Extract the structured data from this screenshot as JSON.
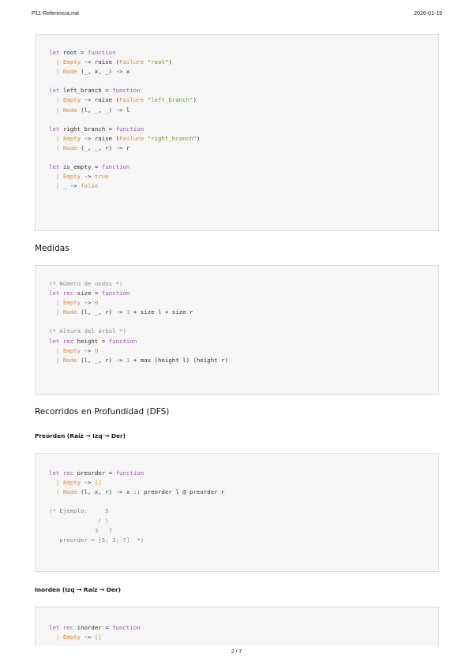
{
  "header": {
    "file_name": "P11-Referencia.md",
    "date": "2026-01-19"
  },
  "footer": {
    "page": "2 / 7"
  },
  "sections": {
    "medidas": "Medidas",
    "dfs": "Recorridos en Profundidad (DFS)",
    "preorden": "Preorden (Raíz → Izq → Der)",
    "inorden": "Inorden (Izq → Raíz → Der)"
  },
  "code_blocks": {
    "block1": [
      [
        {
          "t": "let ",
          "c": "kw"
        },
        {
          "t": "root = "
        },
        {
          "t": "function",
          "c": "kw"
        }
      ],
      [
        {
          "t": "  "
        },
        {
          "t": "|",
          "c": "bar"
        },
        {
          "t": " "
        },
        {
          "t": "Empty",
          "c": "ctor"
        },
        {
          "t": " -> raise ("
        },
        {
          "t": "Failure",
          "c": "ctor"
        },
        {
          "t": " "
        },
        {
          "t": "\"root\"",
          "c": "str"
        },
        {
          "t": ")"
        }
      ],
      [
        {
          "t": "  "
        },
        {
          "t": "|",
          "c": "bar"
        },
        {
          "t": " "
        },
        {
          "t": "Node",
          "c": "ctor"
        },
        {
          "t": " (_, x, _) -> x"
        }
      ],
      [
        {
          "t": ""
        }
      ],
      [
        {
          "t": "let ",
          "c": "kw"
        },
        {
          "t": "left_branch = "
        },
        {
          "t": "function",
          "c": "kw"
        }
      ],
      [
        {
          "t": "  "
        },
        {
          "t": "|",
          "c": "bar"
        },
        {
          "t": " "
        },
        {
          "t": "Empty",
          "c": "ctor"
        },
        {
          "t": " -> raise ("
        },
        {
          "t": "Failure",
          "c": "ctor"
        },
        {
          "t": " "
        },
        {
          "t": "\"left_branch\"",
          "c": "str"
        },
        {
          "t": ")"
        }
      ],
      [
        {
          "t": "  "
        },
        {
          "t": "|",
          "c": "bar"
        },
        {
          "t": " "
        },
        {
          "t": "Node",
          "c": "ctor"
        },
        {
          "t": " (l, _, _) -> l"
        }
      ],
      [
        {
          "t": ""
        }
      ],
      [
        {
          "t": "let ",
          "c": "kw"
        },
        {
          "t": "right_branch = "
        },
        {
          "t": "function",
          "c": "kw"
        }
      ],
      [
        {
          "t": "  "
        },
        {
          "t": "|",
          "c": "bar"
        },
        {
          "t": " "
        },
        {
          "t": "Empty",
          "c": "ctor"
        },
        {
          "t": " -> raise ("
        },
        {
          "t": "Failure",
          "c": "ctor"
        },
        {
          "t": " "
        },
        {
          "t": "\"right_branch\"",
          "c": "str"
        },
        {
          "t": ")"
        }
      ],
      [
        {
          "t": "  "
        },
        {
          "t": "|",
          "c": "bar"
        },
        {
          "t": " "
        },
        {
          "t": "Node",
          "c": "ctor"
        },
        {
          "t": " (_, _, r) -> r"
        }
      ],
      [
        {
          "t": ""
        }
      ],
      [
        {
          "t": "let ",
          "c": "kw"
        },
        {
          "t": "is_empty = "
        },
        {
          "t": "function",
          "c": "kw"
        }
      ],
      [
        {
          "t": "  "
        },
        {
          "t": "|",
          "c": "bar"
        },
        {
          "t": " "
        },
        {
          "t": "Empty",
          "c": "ctor"
        },
        {
          "t": " -> "
        },
        {
          "t": "true",
          "c": "ctor"
        }
      ],
      [
        {
          "t": "  "
        },
        {
          "t": "|",
          "c": "bar"
        },
        {
          "t": " _ -> "
        },
        {
          "t": "false",
          "c": "ctor"
        }
      ]
    ],
    "block2": [
      [
        {
          "t": "(* Número de nodos *)",
          "c": "cm"
        }
      ],
      [
        {
          "t": "let ",
          "c": "kw"
        },
        {
          "t": "rec ",
          "c": "kw"
        },
        {
          "t": "size = "
        },
        {
          "t": "function",
          "c": "kw"
        }
      ],
      [
        {
          "t": "  "
        },
        {
          "t": "|",
          "c": "bar"
        },
        {
          "t": " "
        },
        {
          "t": "Empty",
          "c": "ctor"
        },
        {
          "t": " -> "
        },
        {
          "t": "0",
          "c": "num"
        }
      ],
      [
        {
          "t": "  "
        },
        {
          "t": "|",
          "c": "bar"
        },
        {
          "t": " "
        },
        {
          "t": "Node",
          "c": "ctor"
        },
        {
          "t": " (l, _, r) -> "
        },
        {
          "t": "1",
          "c": "num"
        },
        {
          "t": " + size l + size r"
        }
      ],
      [
        {
          "t": ""
        }
      ],
      [
        {
          "t": "(* Altura del árbol *)",
          "c": "cm"
        }
      ],
      [
        {
          "t": "let ",
          "c": "kw"
        },
        {
          "t": "rec ",
          "c": "kw"
        },
        {
          "t": "height = "
        },
        {
          "t": "function",
          "c": "kw"
        }
      ],
      [
        {
          "t": "  "
        },
        {
          "t": "|",
          "c": "bar"
        },
        {
          "t": " "
        },
        {
          "t": "Empty",
          "c": "ctor"
        },
        {
          "t": " -> "
        },
        {
          "t": "0",
          "c": "num"
        }
      ],
      [
        {
          "t": "  "
        },
        {
          "t": "|",
          "c": "bar"
        },
        {
          "t": " "
        },
        {
          "t": "Node",
          "c": "ctor"
        },
        {
          "t": " (l, _, r) -> "
        },
        {
          "t": "1",
          "c": "num"
        },
        {
          "t": " + max (height l) (height r)"
        }
      ]
    ],
    "block3": [
      [
        {
          "t": "let ",
          "c": "kw"
        },
        {
          "t": "rec ",
          "c": "kw"
        },
        {
          "t": "preorder = "
        },
        {
          "t": "function",
          "c": "kw"
        }
      ],
      [
        {
          "t": "  "
        },
        {
          "t": "|",
          "c": "bar"
        },
        {
          "t": " "
        },
        {
          "t": "Empty",
          "c": "ctor"
        },
        {
          "t": " -> "
        },
        {
          "t": "[]",
          "c": "ctor"
        }
      ],
      [
        {
          "t": "  "
        },
        {
          "t": "|",
          "c": "bar"
        },
        {
          "t": " "
        },
        {
          "t": "Node",
          "c": "ctor"
        },
        {
          "t": " (l, x, r) -> x :: preorder l @ preorder r"
        }
      ],
      [
        {
          "t": ""
        }
      ],
      [
        {
          "t": "(* Ejemplo:     5",
          "c": "cm"
        }
      ],
      [
        {
          "t": "              / \\",
          "c": "cm"
        }
      ],
      [
        {
          "t": "             3   7",
          "c": "cm"
        }
      ],
      [
        {
          "t": "   preorder = [5; 3; 7]  *)",
          "c": "cm"
        }
      ]
    ],
    "block4": [
      [
        {
          "t": "let ",
          "c": "kw"
        },
        {
          "t": "rec ",
          "c": "kw"
        },
        {
          "t": "inorder = "
        },
        {
          "t": "function",
          "c": "kw"
        }
      ],
      [
        {
          "t": "  "
        },
        {
          "t": "|",
          "c": "bar"
        },
        {
          "t": " "
        },
        {
          "t": "Empty",
          "c": "ctor"
        },
        {
          "t": " -> "
        },
        {
          "t": "[]",
          "c": "ctor"
        }
      ]
    ]
  }
}
